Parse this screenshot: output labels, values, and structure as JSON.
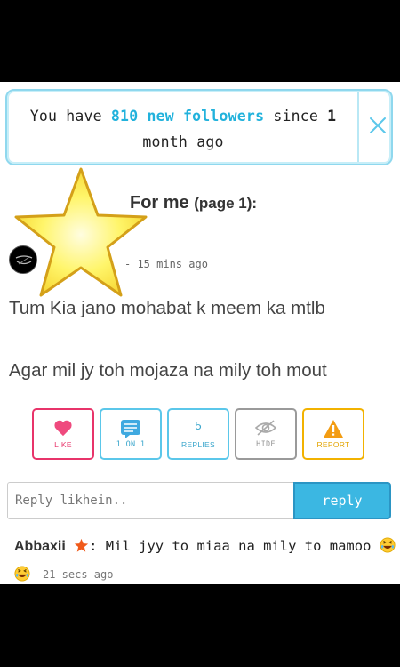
{
  "notification": {
    "prefix": "You have ",
    "highlight": "810 new followers",
    "middle": " since ",
    "bold": "1",
    "suffix": " month ago"
  },
  "feed": {
    "title": "For me",
    "page": "(page 1):"
  },
  "post": {
    "time": "- 15 mins ago",
    "line1": "Tum Kia jano mohabat k meem ka mtlb",
    "line2": "Agar mil jy toh mojaza na mily toh mout"
  },
  "actions": {
    "like": "LIKE",
    "one_on_one": "1 ON 1",
    "replies_count": "5",
    "replies": "REPLIES",
    "hide": "HIDE",
    "report": "REPORT"
  },
  "reply": {
    "placeholder": "Reply likhein..",
    "button": "reply"
  },
  "comment": {
    "author": "Abbaxii",
    "text": ": Mil jyy to miaa na mily to mamoo",
    "time": "21 secs ago"
  },
  "colors": {
    "accent": "#3bb7e2",
    "like": "#e8346a",
    "report": "#f2b200",
    "star": "#fff56a"
  },
  "icons": {
    "close": "close-icon",
    "star": "star-icon",
    "heart": "heart-icon",
    "chat": "chat-icon",
    "hide": "eye-off-icon",
    "warning": "warning-icon",
    "emoji": "laughing-emoji-icon"
  }
}
